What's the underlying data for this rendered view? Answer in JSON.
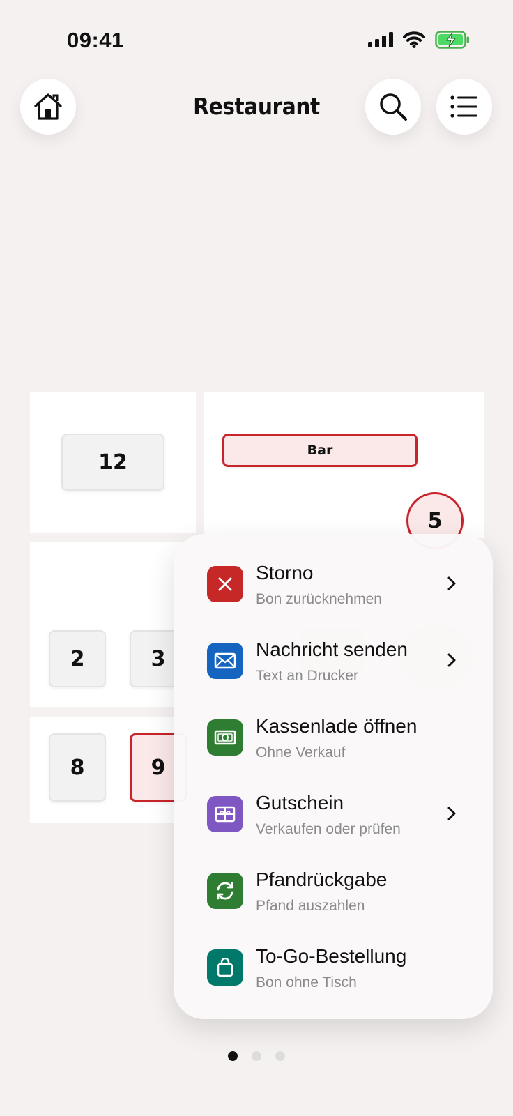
{
  "status_bar": {
    "time": "09:41"
  },
  "header": {
    "title": "Restaurant"
  },
  "floor_plan": {
    "tables": {
      "t12": "12",
      "bar": "Bar",
      "t5": "5",
      "t2": "2",
      "t3": "3",
      "t8": "8",
      "t9": "9"
    }
  },
  "menu": {
    "items": [
      {
        "title": "Storno",
        "subtitle": "Bon zurücknehmen",
        "icon": "x-icon",
        "color": "#c62828",
        "has_chevron": true
      },
      {
        "title": "Nachricht senden",
        "subtitle": "Text an Drucker",
        "icon": "envelope-icon",
        "color": "#1565c0",
        "has_chevron": true
      },
      {
        "title": "Kassenlade öffnen",
        "subtitle": "Ohne Verkauf",
        "icon": "cash-icon",
        "color": "#2e7d32",
        "has_chevron": false
      },
      {
        "title": "Gutschein",
        "subtitle": "Verkaufen oder prüfen",
        "icon": "gift-icon",
        "color": "#7e57c2",
        "has_chevron": true
      },
      {
        "title": "Pfandrückgabe",
        "subtitle": "Pfand auszahlen",
        "icon": "recycle-icon",
        "color": "#2e7d32",
        "has_chevron": false
      },
      {
        "title": "To-Go-Bestellung",
        "subtitle": "Bon ohne Tisch",
        "icon": "bag-icon",
        "color": "#00796b",
        "has_chevron": false
      }
    ]
  },
  "pagination": {
    "current": 1,
    "total": 3
  }
}
